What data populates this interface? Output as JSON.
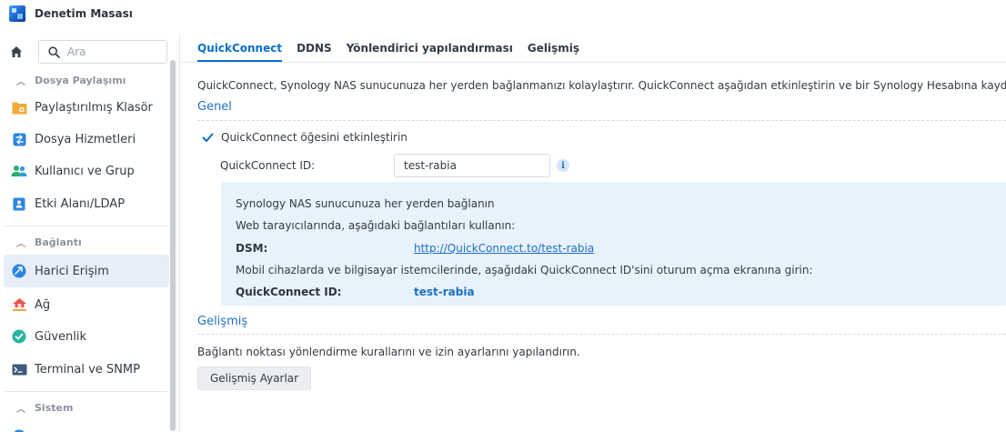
{
  "window": {
    "title": "Denetim Masası"
  },
  "sidebar": {
    "search_placeholder": "Ara",
    "sections": [
      {
        "label": "Dosya Paylaşımı"
      },
      {
        "label": "Bağlantı"
      },
      {
        "label": "Sistem"
      }
    ],
    "items": [
      {
        "label": "Paylaştırılmış Klasör",
        "icon": "shared-folder-icon"
      },
      {
        "label": "Dosya Hizmetleri",
        "icon": "file-services-icon"
      },
      {
        "label": "Kullanıcı ve Grup",
        "icon": "user-group-icon"
      },
      {
        "label": "Etki Alanı/LDAP",
        "icon": "domain-ldap-icon"
      },
      {
        "label": "Harici Erişim",
        "icon": "external-access-icon",
        "active": true
      },
      {
        "label": "Ağ",
        "icon": "network-icon"
      },
      {
        "label": "Güvenlik",
        "icon": "security-shield-icon"
      },
      {
        "label": "Terminal ve SNMP",
        "icon": "terminal-icon"
      }
    ]
  },
  "tabs": [
    {
      "label": "QuickConnect",
      "active": true
    },
    {
      "label": "DDNS"
    },
    {
      "label": "Yönlendirici yapılandırması"
    },
    {
      "label": "Gelişmiş"
    }
  ],
  "quickconnect": {
    "intro": "QuickConnect, Synology NAS sunucunuza her yerden bağlanmanızı kolaylaştırır. QuickConnect aşağıdan etkinleştirin ve bir Synology Hesabına kaydolun.",
    "general_title": "Genel",
    "enable_label": "QuickConnect öğesini etkinleştirin",
    "enable_checked": true,
    "id_label": "QuickConnect ID:",
    "id_value": "test-rabia",
    "info_box": {
      "line1": "Synology NAS sunucunuza her yerden bağlanın",
      "line2": "Web tarayıcılarında, aşağıdaki bağlantıları kullanın:",
      "dsm_label": "DSM:",
      "dsm_link": "http://QuickConnect.to/test-rabia",
      "line3": "Mobil cihazlarda ve bilgisayar istemcilerinde, aşağıdaki QuickConnect ID'sini oturum açma ekranına girin:",
      "id_label": "QuickConnect ID:",
      "id_value": "test-rabia"
    },
    "advanced_title": "Gelişmiş",
    "advanced_desc": "Bağlantı noktası yönlendirme kurallarını ve izin ayarlarını yapılandırın.",
    "advanced_button": "Gelişmiş Ayarlar"
  },
  "colors": {
    "accent": "#0a6ecb",
    "group_title": "#1d70c3",
    "active_nav_bg": "#e7eef7",
    "info_box_bg": "#e8f2fb"
  }
}
